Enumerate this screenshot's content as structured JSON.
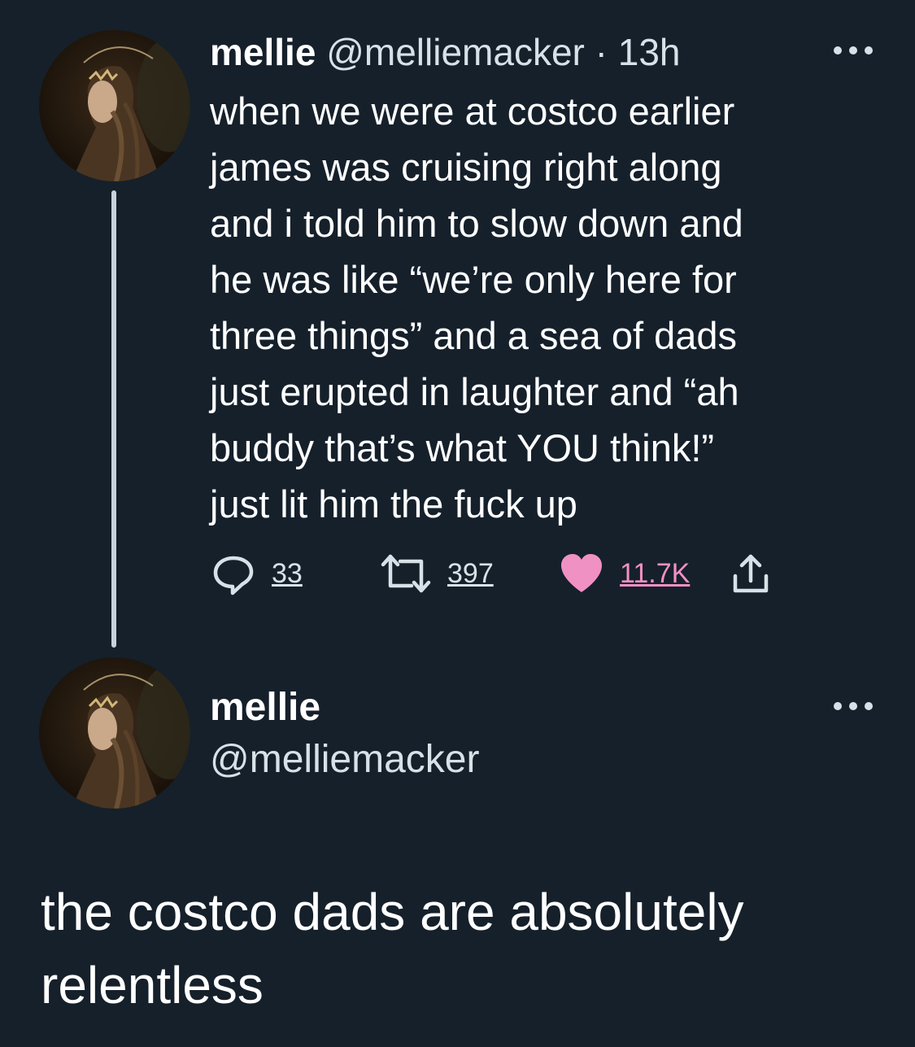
{
  "tweet": {
    "display_name": "mellie",
    "handle": "@melliemacker",
    "separator": "·",
    "time": "13h",
    "more_icon": "more-horizontal-icon",
    "avatar_icon": "avatar-painting",
    "text": "when we were at costco earlier\njames was cruising right along\nand i told him to slow down and\nhe was like “we’re only here for\nthree things” and a sea of dads\njust erupted in laughter and “ah\nbuddy that’s what YOU think!”\njust lit him the fuck up",
    "actions": {
      "reply": {
        "icon": "reply-icon",
        "count": "33"
      },
      "retweet": {
        "icon": "retweet-icon",
        "count": "397"
      },
      "like": {
        "icon": "heart-icon",
        "count": "11.7K",
        "color": "#f091c4"
      },
      "share": {
        "icon": "share-icon"
      }
    }
  },
  "reply": {
    "display_name": "mellie",
    "handle": "@melliemacker",
    "more_icon": "more-horizontal-icon",
    "text": "the costco dads are absolutely relentless"
  },
  "colors": {
    "background": "#15202b",
    "text": "#ffffff",
    "secondary_text": "#d9e1e8",
    "thread_line": "#c8d2dd",
    "like": "#f091c4"
  }
}
